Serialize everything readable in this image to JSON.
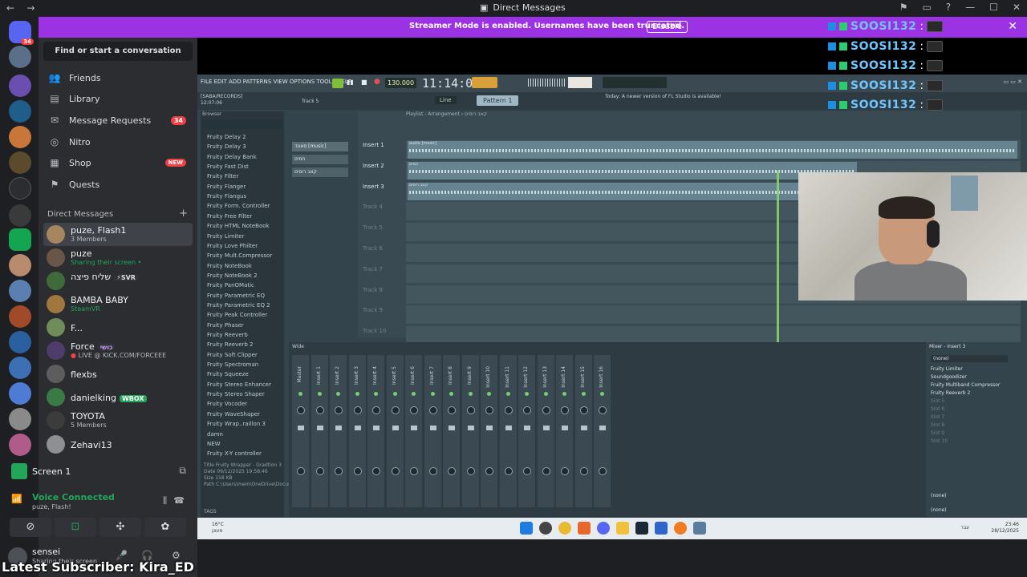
{
  "window": {
    "title": "Direct Messages",
    "nav_back": "←",
    "nav_forward": "→",
    "controls": [
      "⚑",
      "▭",
      "?",
      "—",
      "☐",
      "✕"
    ]
  },
  "banner": {
    "message": "Streamer Mode is enabled. Usernames have been truncated.",
    "disable_label": "Disable",
    "close": "✕"
  },
  "rail": {
    "home_badge": "34"
  },
  "sidebar": {
    "search_placeholder": "Find or start a conversation",
    "nav": [
      {
        "label": "Friends",
        "icon": "friends-icon"
      },
      {
        "label": "Library",
        "icon": "library-icon"
      },
      {
        "label": "Message Requests",
        "icon": "mail-icon",
        "count": "34"
      },
      {
        "label": "Nitro",
        "icon": "nitro-icon"
      },
      {
        "label": "Shop",
        "icon": "shop-icon",
        "badge": "NEW"
      },
      {
        "label": "Quests",
        "icon": "quests-icon"
      }
    ],
    "dm_header": "Direct Messages",
    "dm_plus": "+",
    "dms": [
      {
        "name": "puze, Flash1",
        "sub": "3 Members",
        "color": "#a7855f"
      },
      {
        "name": "puze",
        "sub": "Sharing their screen •",
        "color": "#6a5648"
      },
      {
        "name": "שליח פיצה",
        "tag": "⚡SVR",
        "color": "#3f6b3a"
      },
      {
        "name": "BAMBA BABY",
        "sub": "SteamVR",
        "color": "#a0773f"
      },
      {
        "name": "F...",
        "color": "#6f8d59"
      },
      {
        "name": "Force",
        "tag": "כושי",
        "sub": "LIVE @ KICK.COM/FORCEEE",
        "color": "#4e3c6b"
      },
      {
        "name": "flexbs",
        "color": "#5d5d5d"
      },
      {
        "name": "danielking",
        "tag": "WBOX",
        "color": "#3a7a45"
      },
      {
        "name": "TOYOTA",
        "sub": "5 Members",
        "color": "#3c3c3c"
      },
      {
        "name": "Zehavi13",
        "color": "#8d8f91"
      }
    ],
    "screen": {
      "label": "Screen 1"
    },
    "voice": {
      "status": "Voice Connected",
      "channel": "puze, Flash!"
    },
    "user": {
      "name": "sensei",
      "status": "Sharing their screen"
    }
  },
  "fl": {
    "menu": "FILE EDIT ADD PATTERNS VIEW OPTIONS TOOLS HELP",
    "tempo": "130.000",
    "time": "11:14:08",
    "project": "[SABA/RECORDS]",
    "project_time": "12:07:06",
    "track_label": "Track 5",
    "pattern": "Pattern 1",
    "snap": "Line",
    "news": "Today: A newer version of FL Studio is available!",
    "playlist_title": "Playlist - Arrangement › קאב רוסים",
    "browser_title": "Browser",
    "browser_items": [
      "Fruity Delay 2",
      "Fruity Delay 3",
      "Fruity Delay Bank",
      "Fruity Fast Dist",
      "Fruity Filter",
      "Fruity Flanger",
      "Fruity Flangus",
      "Fruity Form. Controller",
      "Fruity Free Filter",
      "Fruity HTML NoteBook",
      "Fruity Limiter",
      "Fruity Love Philter",
      "Fruity Mult.Compressor",
      "Fruity NoteBook",
      "Fruity NoteBook 2",
      "Fruity PanOMatic",
      "Fruity Parametric EQ",
      "Fruity Parametric EQ 2",
      "Fruity Peak Controller",
      "Fruity Phaser",
      "Fruity Reeverb",
      "Fruity Reeverb 2",
      "Fruity Soft Clipper",
      "Fruity Spectroman",
      "Fruity Squeeze",
      "Fruity Stereo Enhancer",
      "Fruity Stereo Shaper",
      "Fruity Vocoder",
      "Fruity WaveShaper",
      "Fruity Wrap..raillon 3",
      "damn",
      "NEW",
      "Fruity X-Y controller"
    ],
    "browser_meta": [
      "Title   Fruity Wrapper - Gradtion 3",
      "Date    09/12/2025 19:58:46",
      "Size    158 KB",
      "Path    C:\\Users\\mem\\OneDrive\\Documents\\Image-Line\\FL Studio\\Presets\\Plugin presets\\Effects\\Fruity Wrapper - G..."
    ],
    "browser_tags": "TAGS",
    "channels": [
      "סאונד [music]",
      "חמים",
      "קאב רוסים"
    ],
    "tracks": [
      "Insert 1",
      "Insert 2",
      "Insert 3",
      "Track 4",
      "Track 5",
      "Track 6",
      "Track 7",
      "Track 8",
      "Track 9",
      "Track 10"
    ],
    "clips": [
      "audio [music]",
      "חמים",
      "קאב רוסים"
    ],
    "mixer_title": "Wide",
    "mixer_strips": [
      "Master",
      "Insert 1",
      "Insert 2",
      "Insert 3",
      "Insert 4",
      "Insert 5",
      "Insert 6",
      "Insert 7",
      "Insert 8",
      "Insert 9",
      "Insert 10",
      "Insert 11",
      "Insert 12",
      "Insert 13",
      "Insert 14",
      "Insert 15",
      "Insert 16"
    ],
    "insert": {
      "title": "Mixer - Insert 3",
      "none_top": "(none)",
      "slots": [
        "Fruity Limiter",
        "Soundgoodizer",
        "Fruity Multiband Compressor",
        "Fruity Reeverb 2",
        "Slot 5",
        "Slot 6",
        "Slot 7",
        "Slot 8",
        "Slot 9",
        "Slot 10"
      ],
      "none_bottom_1": "(none)",
      "none_bottom_2": "(none)"
    }
  },
  "chat": {
    "name": "SOOSI132",
    "colon": ":",
    "lines": 5
  },
  "taskbar": {
    "temp": "16°C",
    "weather": "מעונן",
    "lang": "עבר",
    "time": "23:46",
    "date": "28/12/2025"
  },
  "overlay": {
    "subscriber": "Latest Subscriber: Kira_ED"
  }
}
